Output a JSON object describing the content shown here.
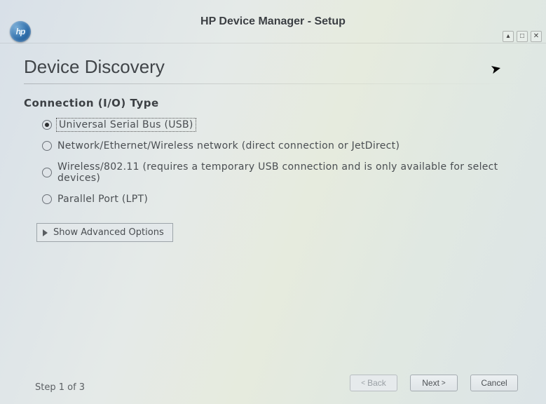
{
  "window": {
    "title": "HP Device Manager - Setup",
    "logo_text": "hp"
  },
  "page": {
    "heading": "Device Discovery",
    "section_label": "Connection (I/O) Type"
  },
  "options": {
    "usb": "Universal Serial Bus (USB)",
    "network": "Network/Ethernet/Wireless network (direct connection or JetDirect)",
    "wireless": "Wireless/802.11 (requires a temporary USB connection and is only available for select devices)",
    "parallel": "Parallel Port (LPT)"
  },
  "advanced_button": "Show Advanced Options",
  "footer": {
    "step_text": "Step 1 of 3",
    "back": "Back",
    "next": "Next",
    "cancel": "Cancel"
  }
}
